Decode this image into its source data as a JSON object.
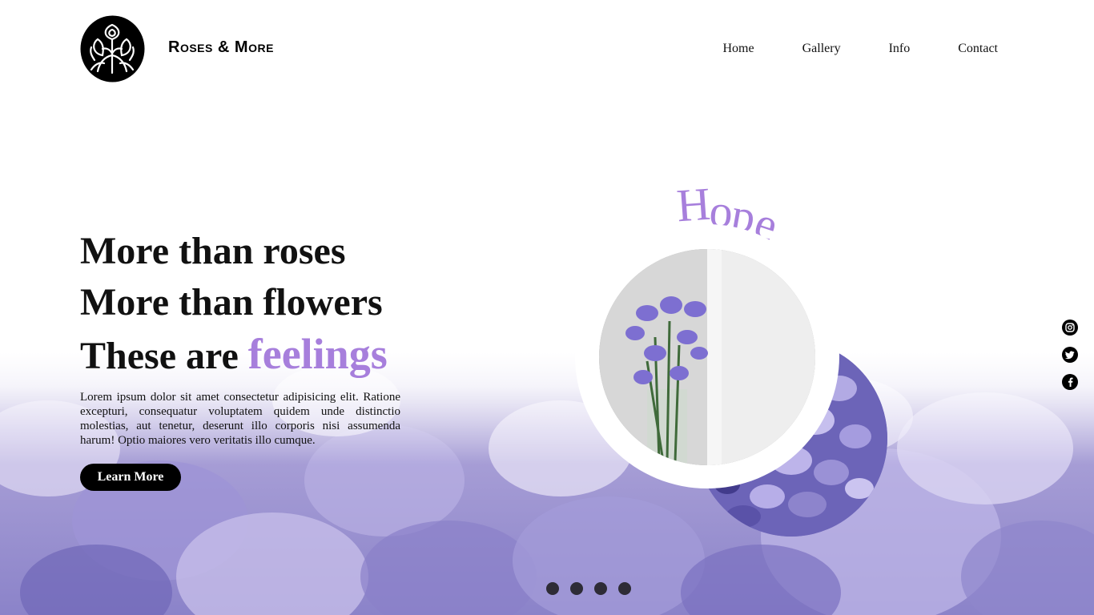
{
  "brand": {
    "name": "Roses & More"
  },
  "nav": {
    "items": [
      "Home",
      "Gallery",
      "Info",
      "Contact"
    ]
  },
  "hero": {
    "line1": "More than roses",
    "line2": "More than flowers",
    "line3_prefix": "These are ",
    "line3_accent": "feelings",
    "body": "Lorem ipsum dolor sit amet consectetur adipisicing elit. Ratione excepturi, consequatur voluptatem quidem unde distinctio molestias, aut tenetur, deserunt illo corporis nisi assumenda harum! Optio maiores vero veritatis illo cumque.",
    "cta_label": "Learn More"
  },
  "feature": {
    "word_letters": [
      "H",
      "o",
      "p",
      "e"
    ]
  },
  "social": {
    "icons": [
      "instagram-icon",
      "twitter-icon",
      "facebook-icon"
    ]
  },
  "slider": {
    "dot_count": 4
  },
  "colors": {
    "accent": "#a77fdc",
    "dark": "#000000",
    "lavender": "#a79ed6"
  }
}
